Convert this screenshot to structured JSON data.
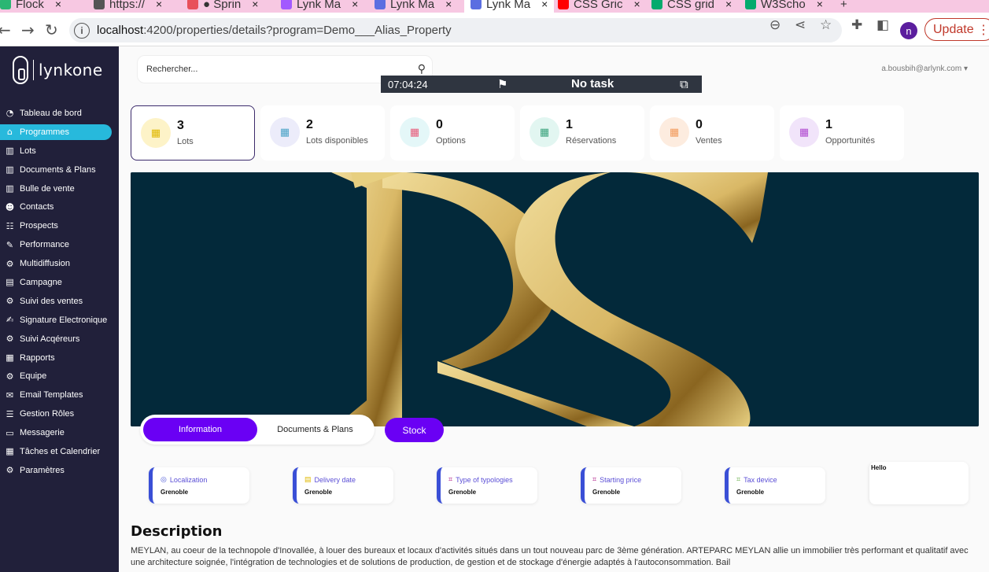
{
  "browser": {
    "tabs": [
      {
        "label": "Flock",
        "color": "#2bb673"
      },
      {
        "label": "https://",
        "color": "#555555"
      },
      {
        "label": "● Sprin",
        "color": "#e8505b"
      },
      {
        "label": "Lynk Ma",
        "color": "#a259ff"
      },
      {
        "label": "Lynk Ma",
        "color": "#5b6ee1"
      },
      {
        "label": "Lynk Ma",
        "color": "#5b6ee1"
      },
      {
        "label": "CSS Gric",
        "color": "#ff0000"
      },
      {
        "label": "CSS grid",
        "color": "#04aa6d"
      },
      {
        "label": "W3Scho",
        "color": "#04aa6d"
      }
    ],
    "url_host": "localhost",
    "url_path": ":4200/properties/details?program=Demo___Alias_Property",
    "profile_initial": "n",
    "update_label": "Update"
  },
  "sidebar": {
    "logo_text": "lynkone",
    "items": [
      {
        "label": "Tableau de bord",
        "icon": "dashboard-icon",
        "glyph": "◔"
      },
      {
        "label": "Programmes",
        "icon": "home-icon",
        "glyph": "⌂"
      },
      {
        "label": "Lots",
        "icon": "building-icon",
        "glyph": "▥"
      },
      {
        "label": "Documents & Plans",
        "icon": "building-icon",
        "glyph": "▥"
      },
      {
        "label": "Bulle de vente",
        "icon": "building-icon",
        "glyph": "▥"
      },
      {
        "label": "Contacts",
        "icon": "contacts-icon",
        "glyph": "☻"
      },
      {
        "label": "Prospects",
        "icon": "prospects-icon",
        "glyph": "☷"
      },
      {
        "label": "Performance",
        "icon": "performance-icon",
        "glyph": "✎"
      },
      {
        "label": "Multidiffusion",
        "icon": "broadcast-icon",
        "glyph": "⚙"
      },
      {
        "label": "Campagne",
        "icon": "campaign-icon",
        "glyph": "▤"
      },
      {
        "label": "Suivi des ventes",
        "icon": "sales-icon",
        "glyph": "⚙"
      },
      {
        "label": "Signature Electronique",
        "icon": "signature-icon",
        "glyph": "✍"
      },
      {
        "label": "Suivi Acqéreurs",
        "icon": "buyers-icon",
        "glyph": "⚙"
      },
      {
        "label": "Rapports",
        "icon": "reports-icon",
        "glyph": "▦"
      },
      {
        "label": "Equipe",
        "icon": "team-icon",
        "glyph": "⚙"
      },
      {
        "label": "Email Templates",
        "icon": "email-icon",
        "glyph": "✉"
      },
      {
        "label": "Gestion Rôles",
        "icon": "roles-icon",
        "glyph": "☰"
      },
      {
        "label": "Messagerie",
        "icon": "message-icon",
        "glyph": "▭"
      },
      {
        "label": "Tâches et Calendrier",
        "icon": "calendar-icon",
        "glyph": "▦"
      },
      {
        "label": "Paramètres",
        "icon": "gear-icon",
        "glyph": "⚙"
      }
    ]
  },
  "header": {
    "search_placeholder": "Rechercher...",
    "user_email": "a.bousbih@arlynk.com ▾"
  },
  "timer": {
    "time": "07:04:24",
    "task": "No task"
  },
  "stats": [
    {
      "value": "3",
      "label": "Lots",
      "bg": "#fdf3c8",
      "fg": "#e0b800"
    },
    {
      "value": "2",
      "label": "Lots disponibles",
      "bg": "#ececfa",
      "fg": "#4aa3c7"
    },
    {
      "value": "0",
      "label": "Options",
      "bg": "#e4f7f8",
      "fg": "#e85a7a"
    },
    {
      "value": "1",
      "label": "Réservations",
      "bg": "#e2f6f1",
      "fg": "#3aa37d"
    },
    {
      "value": "0",
      "label": "Ventes",
      "bg": "#fdecdf",
      "fg": "#f29a5b"
    },
    {
      "value": "1",
      "label": "Opportunités",
      "bg": "#f1e4fa",
      "fg": "#b04ad0"
    }
  ],
  "tabs": {
    "information": "Information",
    "documents": "Documents & Plans",
    "stock": "Stock"
  },
  "info_cards": [
    {
      "title": "Localization",
      "value": "Grenoble",
      "icon": "location-icon",
      "glyph": "◎",
      "color": "#4a56d6"
    },
    {
      "title": "Delivery date",
      "value": "Grenoble",
      "icon": "calendar-icon",
      "glyph": "▤",
      "color": "#4a56d6"
    },
    {
      "title": "Type of typologies",
      "value": "Grenoble",
      "icon": "crop-icon",
      "glyph": "⌗",
      "color": "#4a56d6"
    },
    {
      "title": "Starting price",
      "value": "Grenoble",
      "icon": "crop-icon",
      "glyph": "⌗",
      "color": "#4a56d6"
    },
    {
      "title": "Tax device",
      "value": "Grenoble",
      "icon": "crop-icon",
      "glyph": "⌗",
      "color": "#4a56d6"
    }
  ],
  "hello_card": "Hello",
  "description": {
    "title": "Description",
    "text": "MEYLAN, au coeur de la technopole d'Inovallée, à louer des bureaux et locaux d'activités situés dans un tout nouveau parc de 3ème génération. ARTEPARC MEYLAN allie un immobilier très performant et qualitatif avec une architecture soignée, l'intégration de technologies et de solutions de production, de gestion et de stockage d'énergie adaptés à l'autoconsommation. Bail"
  }
}
